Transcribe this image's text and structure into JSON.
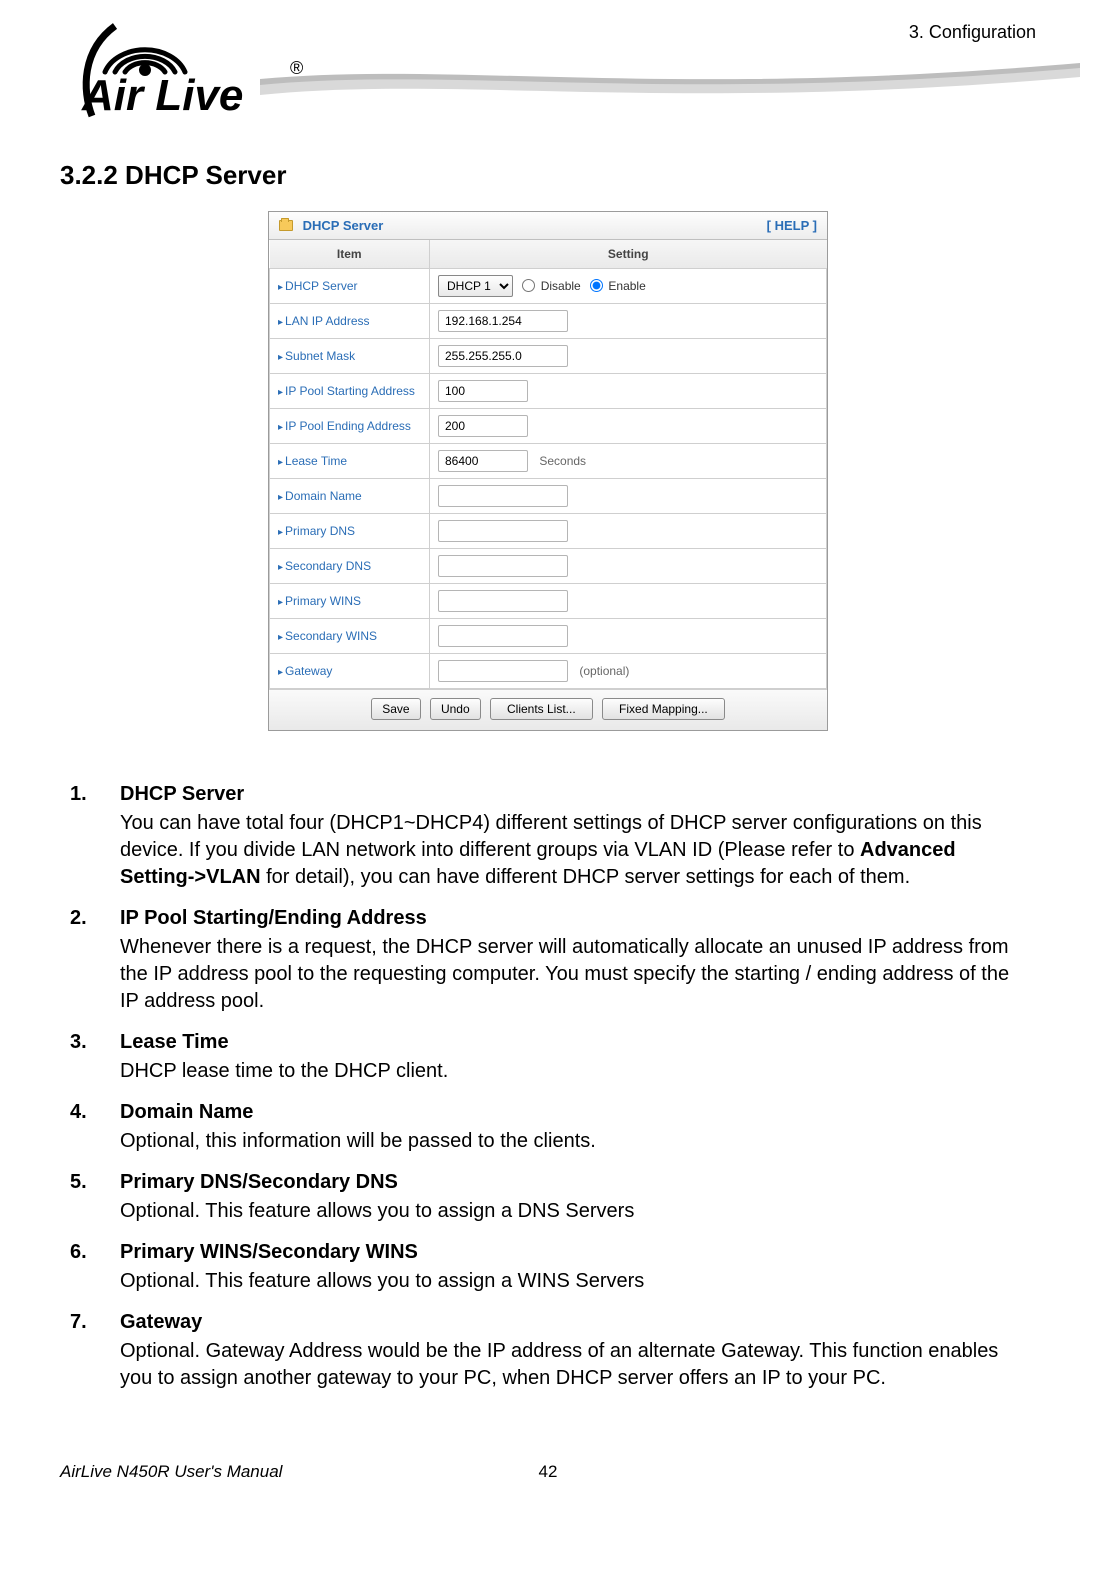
{
  "header": {
    "chapter_ref": "3.  Configuration",
    "logo_text": "Air Live",
    "logo_reg": "®"
  },
  "section": {
    "heading": "3.2.2 DHCP Server"
  },
  "shot": {
    "title": "DHCP Server",
    "help": "[ HELP ]",
    "col_item": "Item",
    "col_setting": "Setting",
    "rows": {
      "dhcp_server": {
        "label": "DHCP Server",
        "select": "DHCP 1",
        "opt_disable": "Disable",
        "opt_enable": "Enable"
      },
      "lan_ip": {
        "label": "LAN IP Address",
        "value": "192.168.1.254"
      },
      "subnet": {
        "label": "Subnet Mask",
        "value": "255.255.255.0"
      },
      "pool_start": {
        "label": "IP Pool Starting Address",
        "value": "100"
      },
      "pool_end": {
        "label": "IP Pool Ending Address",
        "value": "200"
      },
      "lease": {
        "label": "Lease Time",
        "value": "86400",
        "unit": "Seconds"
      },
      "domain": {
        "label": "Domain Name",
        "value": ""
      },
      "pdns": {
        "label": "Primary DNS",
        "value": ""
      },
      "sdns": {
        "label": "Secondary DNS",
        "value": ""
      },
      "pwins": {
        "label": "Primary WINS",
        "value": ""
      },
      "swins": {
        "label": "Secondary WINS",
        "value": ""
      },
      "gateway": {
        "label": "Gateway",
        "value": "",
        "hint": "(optional)"
      }
    },
    "buttons": {
      "save": "Save",
      "undo": "Undo",
      "clients": "Clients List...",
      "fixed": "Fixed Mapping..."
    }
  },
  "desc": [
    {
      "num": "1.",
      "title": "DHCP Server",
      "body_pre": "You can have total four (DHCP1~DHCP4) different settings of DHCP server configurations on this device. If you divide LAN network into different groups via VLAN ID (Please refer to ",
      "body_bold": "Advanced Setting->VLAN",
      "body_post": " for detail), you can have different DHCP server settings for each of them.",
      "justify": true
    },
    {
      "num": "2.",
      "title": "IP Pool Starting/Ending Address",
      "body_pre": "Whenever there is a request, the DHCP server will automatically allocate an unused IP address from the IP address pool to the requesting computer. You must specify the starting / ending address of the IP address pool.",
      "body_bold": "",
      "body_post": "",
      "justify": false
    },
    {
      "num": "3.",
      "title": "Lease Time",
      "body_pre": "DHCP lease time to the DHCP client.",
      "body_bold": "",
      "body_post": "",
      "justify": false
    },
    {
      "num": "4.",
      "title": "Domain Name",
      "body_pre": "Optional, this information will be passed to the clients.",
      "body_bold": "",
      "body_post": "",
      "justify": false
    },
    {
      "num": "5.",
      "title": "Primary DNS/Secondary DNS",
      "body_pre": "Optional. This feature allows you to assign a DNS Servers",
      "body_bold": "",
      "body_post": "",
      "justify": false
    },
    {
      "num": "6.",
      "title": "Primary WINS/Secondary WINS",
      "body_pre": "Optional. This feature allows you to assign a WINS Servers",
      "body_bold": "",
      "body_post": "",
      "justify": false
    },
    {
      "num": "7.",
      "title": "Gateway",
      "body_pre": "Optional. Gateway Address would be the IP address of an alternate Gateway. This function enables you to assign another gateway to your PC, when DHCP server offers an IP to your PC.",
      "body_bold": "",
      "body_post": "",
      "justify": true
    }
  ],
  "footer": {
    "manual": "AirLive N450R User's Manual",
    "page": "42"
  }
}
